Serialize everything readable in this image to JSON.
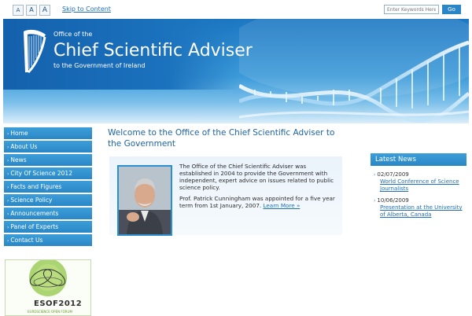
{
  "utility": {
    "font_sizes": [
      "A",
      "A",
      "A"
    ],
    "skip_link": "Skip to Content",
    "search_placeholder": "Enter Keywords Here",
    "go_label": "Go"
  },
  "banner": {
    "office_of": "Office of the",
    "title": "Chief Scientific Adviser",
    "subtitle": "to the Government of Ireland"
  },
  "nav": {
    "items": [
      {
        "label": "Home"
      },
      {
        "label": "About Us"
      },
      {
        "label": "News"
      },
      {
        "label": "City Of Science 2012"
      },
      {
        "label": "Facts and Figures"
      },
      {
        "label": "Science Policy"
      },
      {
        "label": "Announcements"
      },
      {
        "label": "Panel of Experts"
      },
      {
        "label": "Contact Us"
      }
    ],
    "arrow": "›"
  },
  "esof": {
    "label": "ESOF2012",
    "sub": "EUROSCIENCE OPEN FORUM"
  },
  "main": {
    "welcome": "Welcome to the Office of the Chief Scientific Adviser to the Government",
    "para1": "The Office of the Chief Scientific Adviser was established in 2004 to provide the Government with independent, expert advice on issues related to public science policy.",
    "para2_text": "Prof. Patrick Cunningham was appointed for a five year term from 1st January, 2007.",
    "learn_more": "Learn More »"
  },
  "news": {
    "heading": "Latest News",
    "items": [
      {
        "date": "02/07/2009",
        "link": "World Conference of Science Journalists"
      },
      {
        "date": "10/06/2009",
        "link": "Presentation at the University of Alberta, Canada"
      }
    ]
  },
  "colors": {
    "brand_blue": "#2a87c6",
    "link_blue": "#1e6fb5",
    "heading_blue": "#1f63a3"
  }
}
